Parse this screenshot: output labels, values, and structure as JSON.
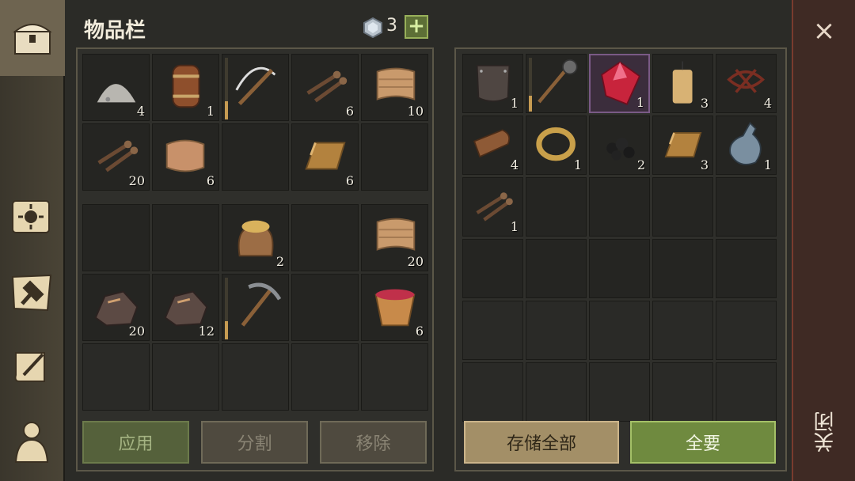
{
  "header": {
    "title": "物品栏",
    "currency_count": "3",
    "add_label": "+"
  },
  "inventory": {
    "top_rows": [
      {
        "icon": "stone-dust-icon",
        "count": "4"
      },
      {
        "icon": "barrel-icon",
        "count": "1"
      },
      {
        "icon": "crossbow-icon",
        "count": "",
        "durability": 0.3
      },
      {
        "icon": "nails-icon",
        "count": "6"
      },
      {
        "icon": "cloth-icon",
        "count": "10"
      },
      {
        "icon": "nails-icon",
        "count": "20"
      },
      {
        "icon": "leather-icon",
        "count": "6"
      },
      {
        "icon": "empty-icon",
        "count": ""
      },
      {
        "icon": "ingot-icon",
        "count": "6"
      },
      {
        "icon": "empty-icon",
        "count": ""
      }
    ],
    "bottom_rows": [
      {
        "icon": "empty-icon",
        "count": ""
      },
      {
        "icon": "empty-icon",
        "count": ""
      },
      {
        "icon": "grain-sack-icon",
        "count": "2"
      },
      {
        "icon": "empty-icon",
        "count": ""
      },
      {
        "icon": "cloth-icon",
        "count": "20"
      },
      {
        "icon": "ore-icon",
        "count": "20"
      },
      {
        "icon": "ore-icon",
        "count": "12"
      },
      {
        "icon": "pickaxe-icon",
        "count": "",
        "durability": 0.3
      },
      {
        "icon": "empty-icon",
        "count": ""
      },
      {
        "icon": "berry-bowl-icon",
        "count": "6"
      },
      {
        "icon": "empty-icon",
        "count": ""
      },
      {
        "icon": "empty-icon",
        "count": ""
      },
      {
        "icon": "empty-icon",
        "count": ""
      },
      {
        "icon": "empty-icon",
        "count": ""
      },
      {
        "icon": "empty-icon",
        "count": ""
      }
    ],
    "buttons": {
      "apply": "应用",
      "split": "分割",
      "remove": "移除"
    }
  },
  "storage": {
    "slots": [
      {
        "icon": "shield-plate-icon",
        "count": "1"
      },
      {
        "icon": "mace-icon",
        "count": "",
        "durability": 0.3
      },
      {
        "icon": "ruby-icon",
        "count": "1",
        "selected": true
      },
      {
        "icon": "candle-icon",
        "count": "3"
      },
      {
        "icon": "tangle-icon",
        "count": "4"
      },
      {
        "icon": "leather-roll-icon",
        "count": "4"
      },
      {
        "icon": "ring-icon",
        "count": "1"
      },
      {
        "icon": "coal-icon",
        "count": "2"
      },
      {
        "icon": "ingot-icon",
        "count": "3"
      },
      {
        "icon": "potion-icon",
        "count": "1"
      },
      {
        "icon": "nails-icon",
        "count": "1"
      }
    ],
    "total_slots": 30,
    "buttons": {
      "store_all": "存储全部",
      "take_all": "全要"
    }
  },
  "close": {
    "x": "×",
    "label": "关闭"
  },
  "colors": {
    "accent_green": "#6f8a3f",
    "close_red": "#7a3b2e",
    "selected_purple": "#7a5a86"
  }
}
